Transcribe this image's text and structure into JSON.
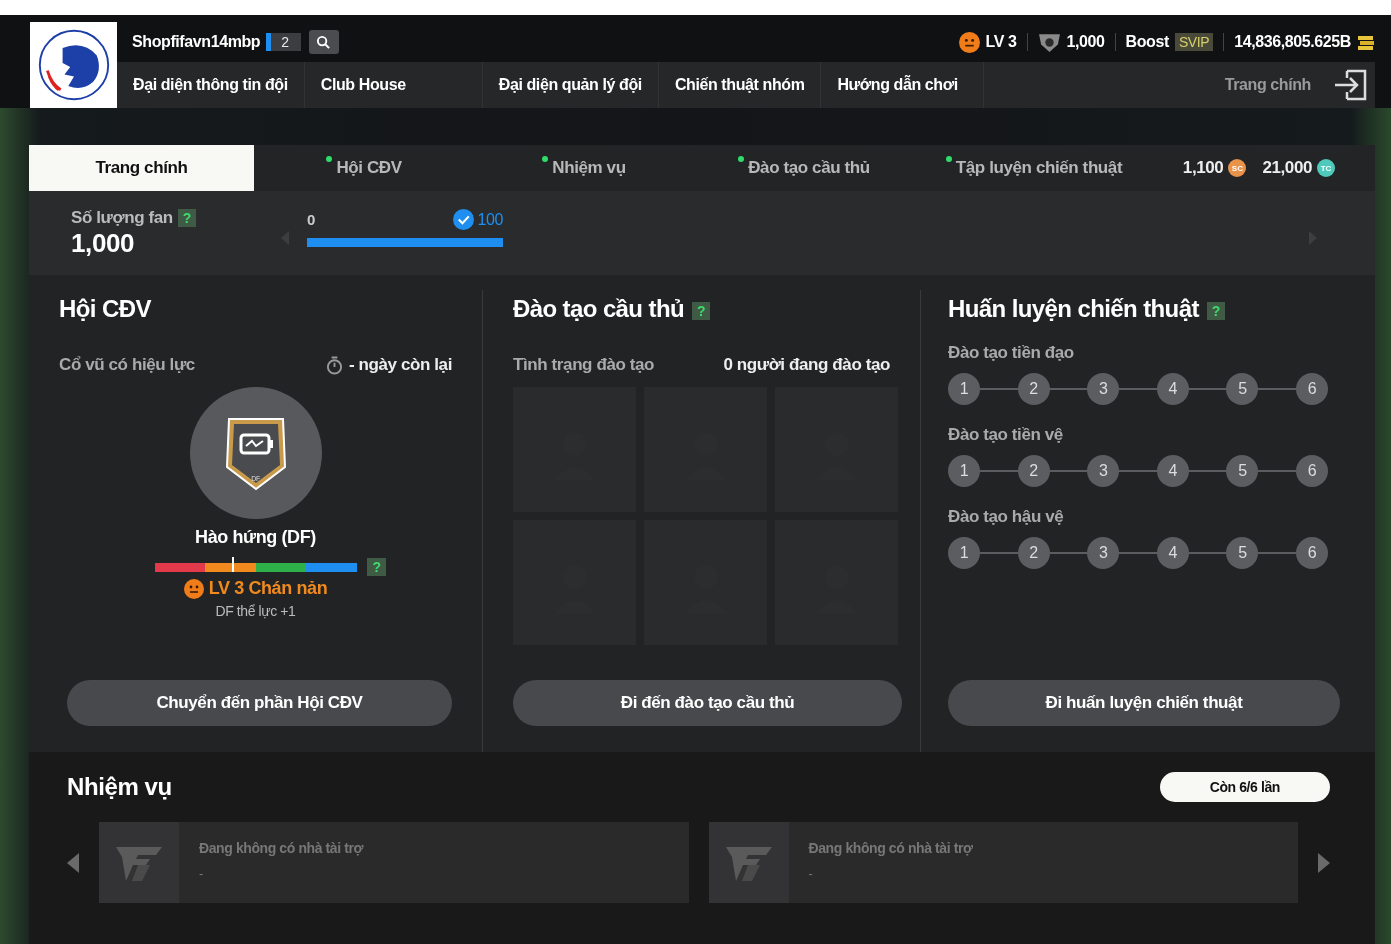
{
  "header": {
    "username": "Shopfifavn14mbp",
    "badge": "2",
    "level": "LV 3",
    "fans": "1,000",
    "boost": "Boost",
    "vip": "SVIP",
    "balance": "14,836,805.625B"
  },
  "nav": [
    {
      "label": "Đại diện thông tin đội"
    },
    {
      "label": "Club House"
    },
    {
      "label": "Đại diện quản lý đội"
    },
    {
      "label": "Chiến thuật nhóm"
    },
    {
      "label": "Hướng dẫn chơi"
    }
  ],
  "home": "Trang chính",
  "tabs": [
    {
      "label": "Trang chính",
      "selected": true,
      "dot": false
    },
    {
      "label": "Hội CĐV",
      "selected": false,
      "dot": true
    },
    {
      "label": "Nhiệm vụ",
      "selected": false,
      "dot": true
    },
    {
      "label": "Đào tạo cầu thủ",
      "selected": false,
      "dot": true
    },
    {
      "label": "Tập luyện chiến thuật",
      "selected": false,
      "dot": true
    }
  ],
  "currencies": [
    {
      "amount": "1,100",
      "code": "SC",
      "color": "#e8924a"
    },
    {
      "amount": "21,000",
      "code": "TC",
      "color": "#4fc9bc"
    }
  ],
  "fan_count": {
    "label": "Số lượng fan",
    "help": "?",
    "value": "1,000",
    "min": "0",
    "max": "100",
    "level": 1,
    "reached": true
  },
  "fan_club": {
    "title": "Hội CĐV",
    "status": "Cổ vũ có hiệu lực",
    "days": "- ngày còn lại",
    "badge_code": "DF",
    "effect_name": "Hào hứng (DF)",
    "mood_meter": {
      "level": 0.39
    },
    "help": "?",
    "mood": "LV 3 Chán nản",
    "bonus": "DF thể lực +1",
    "button": "Chuyển đến phần Hội CĐV"
  },
  "training": {
    "title": "Đào tạo cầu thủ",
    "help": "?",
    "status": "Tình trạng đào tạo",
    "count": "0 người đang đào tạo",
    "slots": [
      {
        "kind": "empty"
      },
      {
        "kind": "empty"
      },
      {
        "kind": "empty"
      },
      {
        "kind": "empty"
      },
      {
        "kind": "empty"
      },
      {
        "kind": "empty"
      }
    ],
    "button": "Đi đến đào tạo cầu thủ"
  },
  "tactics": {
    "title": "Huấn luyện chiến thuật",
    "help": "?",
    "groups": [
      {
        "label": "Đào tạo tiền đạo",
        "steps": [
          "1",
          "2",
          "3",
          "4",
          "5",
          "6"
        ]
      },
      {
        "label": "Đào tạo tiền vệ",
        "steps": [
          "1",
          "2",
          "3",
          "4",
          "5",
          "6"
        ]
      },
      {
        "label": "Đào tạo hậu vệ",
        "steps": [
          "1",
          "2",
          "3",
          "4",
          "5",
          "6"
        ]
      }
    ],
    "button": "Đi huấn luyện chiến thuật"
  },
  "missions": {
    "title": "Nhiệm vụ",
    "remaining": "Còn 6/6 lần",
    "sponsors": [
      {
        "text": "Đang không có nhà tài trợ",
        "sub": "-"
      },
      {
        "text": "Đang không có nhà tài trợ",
        "sub": "-"
      }
    ]
  }
}
